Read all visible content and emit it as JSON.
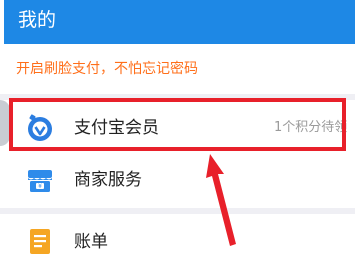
{
  "header": {
    "title": "我的"
  },
  "promo": {
    "text": "开启刷脸支付，不怕忘记密码"
  },
  "menu": [
    {
      "label": "支付宝会员",
      "meta": "1个积分待领",
      "icon": "alipay-member-icon"
    },
    {
      "label": "商家服务",
      "meta": "",
      "icon": "merchant-store-icon"
    },
    {
      "label": "账单",
      "meta": "",
      "icon": "bill-document-icon"
    }
  ],
  "colors": {
    "header_bg": "#1e88e5",
    "promo_text": "#ff6f1a",
    "highlight": "#e8202a"
  }
}
